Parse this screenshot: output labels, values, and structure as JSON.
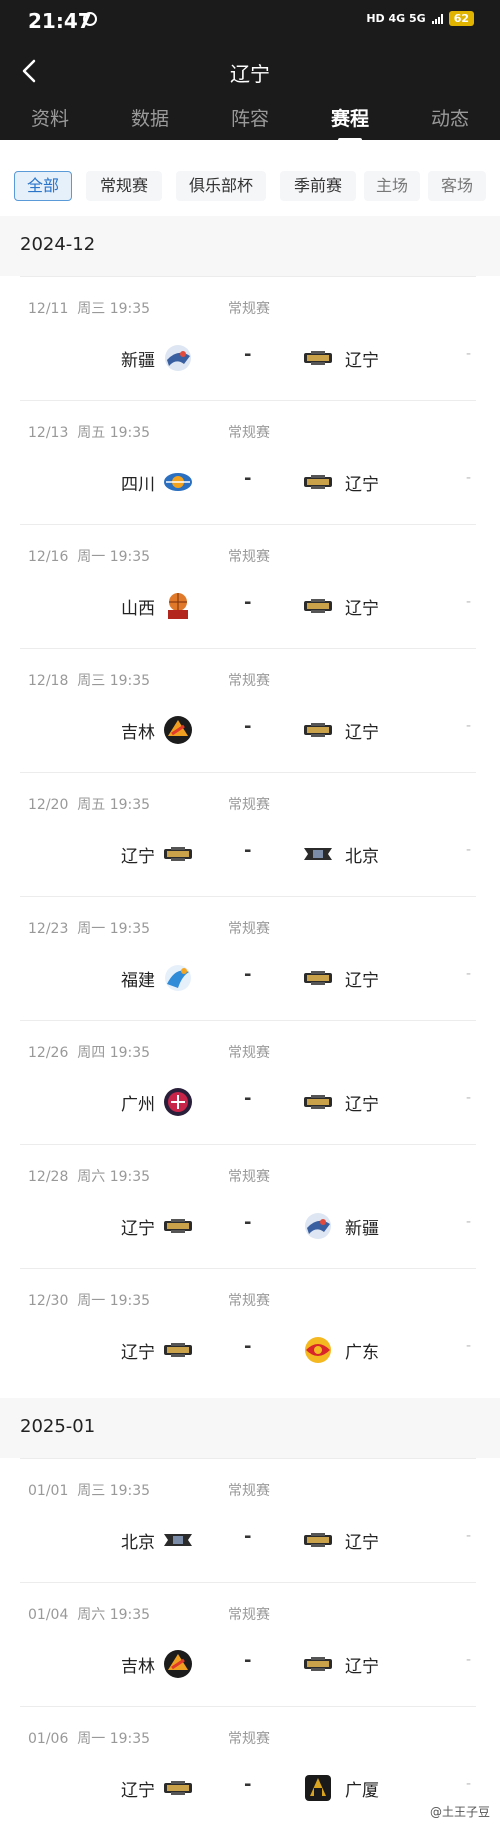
{
  "status_bar": {
    "time": "21:47",
    "network": "HD 4G 5G",
    "battery": "62"
  },
  "header": {
    "title": "辽宁",
    "tabs": [
      {
        "label": "资料"
      },
      {
        "label": "数据"
      },
      {
        "label": "阵容"
      },
      {
        "label": "赛程",
        "active": true
      },
      {
        "label": "动态"
      }
    ]
  },
  "filters": [
    {
      "label": "全部",
      "active": true
    },
    {
      "label": "常规赛"
    },
    {
      "label": "俱乐部杯"
    },
    {
      "label": "季前赛"
    },
    {
      "label": "主场"
    },
    {
      "label": "客场"
    }
  ],
  "months": [
    {
      "label": "2024-12",
      "games": [
        {
          "date": "12/11",
          "weekday": "周三",
          "time": "19:35",
          "type": "常规赛",
          "home": "新疆",
          "home_logo": "xinjiang-logo",
          "away": "辽宁",
          "away_logo": "liaoning-logo",
          "score": "-",
          "extra": "-"
        },
        {
          "date": "12/13",
          "weekday": "周五",
          "time": "19:35",
          "type": "常规赛",
          "home": "四川",
          "home_logo": "sichuan-logo",
          "away": "辽宁",
          "away_logo": "liaoning-logo",
          "score": "-",
          "extra": "-"
        },
        {
          "date": "12/16",
          "weekday": "周一",
          "time": "19:35",
          "type": "常规赛",
          "home": "山西",
          "home_logo": "shanxi-logo",
          "away": "辽宁",
          "away_logo": "liaoning-logo",
          "score": "-",
          "extra": "-"
        },
        {
          "date": "12/18",
          "weekday": "周三",
          "time": "19:35",
          "type": "常规赛",
          "home": "吉林",
          "home_logo": "jilin-logo",
          "away": "辽宁",
          "away_logo": "liaoning-logo",
          "score": "-",
          "extra": "-"
        },
        {
          "date": "12/20",
          "weekday": "周五",
          "time": "19:35",
          "type": "常规赛",
          "home": "辽宁",
          "home_logo": "liaoning-logo",
          "away": "北京",
          "away_logo": "beijing-logo",
          "score": "-",
          "extra": "-"
        },
        {
          "date": "12/23",
          "weekday": "周一",
          "time": "19:35",
          "type": "常规赛",
          "home": "福建",
          "home_logo": "fujian-logo",
          "away": "辽宁",
          "away_logo": "liaoning-logo",
          "score": "-",
          "extra": "-"
        },
        {
          "date": "12/26",
          "weekday": "周四",
          "time": "19:35",
          "type": "常规赛",
          "home": "广州",
          "home_logo": "guangzhou-logo",
          "away": "辽宁",
          "away_logo": "liaoning-logo",
          "score": "-",
          "extra": "-"
        },
        {
          "date": "12/28",
          "weekday": "周六",
          "time": "19:35",
          "type": "常规赛",
          "home": "辽宁",
          "home_logo": "liaoning-logo",
          "away": "新疆",
          "away_logo": "xinjiang-logo",
          "score": "-",
          "extra": "-"
        },
        {
          "date": "12/30",
          "weekday": "周一",
          "time": "19:35",
          "type": "常规赛",
          "home": "辽宁",
          "home_logo": "liaoning-logo",
          "away": "广东",
          "away_logo": "guangdong-logo",
          "score": "-",
          "extra": "-"
        }
      ]
    },
    {
      "label": "2025-01",
      "games": [
        {
          "date": "01/01",
          "weekday": "周三",
          "time": "19:35",
          "type": "常规赛",
          "home": "北京",
          "home_logo": "beijing-logo",
          "away": "辽宁",
          "away_logo": "liaoning-logo",
          "score": "-",
          "extra": "-"
        },
        {
          "date": "01/04",
          "weekday": "周六",
          "time": "19:35",
          "type": "常规赛",
          "home": "吉林",
          "home_logo": "jilin-logo",
          "away": "辽宁",
          "away_logo": "liaoning-logo",
          "score": "-",
          "extra": "-"
        },
        {
          "date": "01/06",
          "weekday": "周一",
          "time": "19:35",
          "type": "常规赛",
          "home": "辽宁",
          "home_logo": "liaoning-logo",
          "away": "广厦",
          "away_logo": "guangsha-logo",
          "score": "-",
          "extra": "-"
        }
      ]
    }
  ],
  "watermark": "@土王子豆",
  "colors": {
    "header_bg": "#1b1b1b",
    "accent": "#2a74c9",
    "section_bg": "#f7f7f7"
  }
}
